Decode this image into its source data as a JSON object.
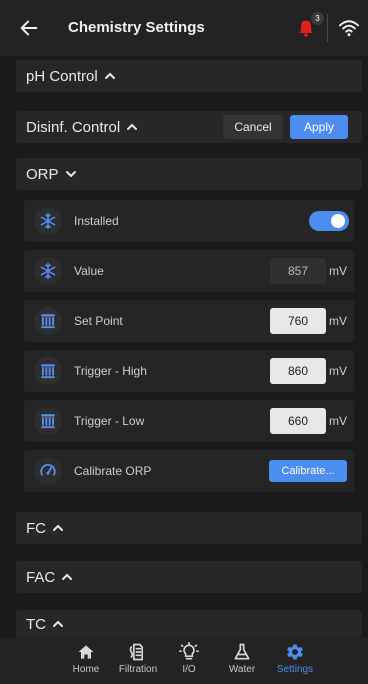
{
  "header": {
    "title": "Chemistry Settings",
    "notification_count": "3"
  },
  "sections": {
    "ph": {
      "label": "pH Control"
    },
    "disinf": {
      "label": "Disinf. Control",
      "cancel_label": "Cancel",
      "apply_label": "Apply"
    },
    "orp": {
      "label": "ORP"
    },
    "fc": {
      "label": "FC"
    },
    "fac": {
      "label": "FAC"
    },
    "tc": {
      "label": "TC"
    }
  },
  "orp_rows": {
    "installed": {
      "label": "Installed",
      "value": true
    },
    "value": {
      "label": "Value",
      "value": "857",
      "unit": "mV"
    },
    "set_point": {
      "label": "Set Point",
      "value": "760",
      "unit": "mV"
    },
    "trigger_high": {
      "label": "Trigger - High",
      "value": "860",
      "unit": "mV"
    },
    "trigger_low": {
      "label": "Trigger - Low",
      "value": "660",
      "unit": "mV"
    },
    "calibrate": {
      "label": "Calibrate ORP",
      "button_label": "Calibrate..."
    }
  },
  "nav": {
    "items": [
      {
        "label": "Home",
        "icon": "home-icon"
      },
      {
        "label": "Filtration",
        "icon": "filtration-icon"
      },
      {
        "label": "I/O",
        "icon": "lightbulb-icon"
      },
      {
        "label": "Water",
        "icon": "flask-icon"
      },
      {
        "label": "Settings",
        "icon": "gear-icon",
        "active": true
      }
    ]
  },
  "colors": {
    "accent": "#4c8df0",
    "notification": "#e02020",
    "background": "#1b1b1b"
  }
}
